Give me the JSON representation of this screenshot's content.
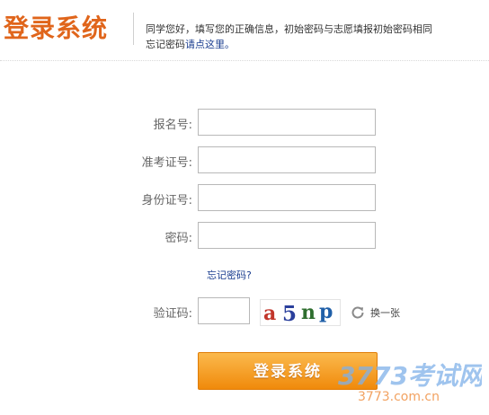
{
  "header": {
    "title": "登录系统",
    "intro_text": "同学您好，填写您的正确信息，初始密码与志愿填报初始密码相同",
    "intro_line2_prefix": "忘记密码",
    "intro_link": "请点这里。"
  },
  "form": {
    "fields": [
      {
        "label": "报名号:",
        "value": ""
      },
      {
        "label": "准考证号:",
        "value": ""
      },
      {
        "label": "身份证号:",
        "value": ""
      },
      {
        "label": "密码:",
        "value": ""
      }
    ],
    "forgot_link": "忘记密码?",
    "captcha": {
      "label": "验证码:",
      "value": "",
      "image_text": "a5np",
      "refresh_label": "换一张"
    },
    "submit_label": "登录系统"
  },
  "watermark": {
    "brand": "3773考试网",
    "url": "3773.com.cn"
  },
  "colors": {
    "brand_orange": "#e0651b",
    "button_top": "#fbb94d",
    "button_bottom": "#f08a0b",
    "link_blue": "#1a3d8f",
    "watermark_blue": "#2f6fc4"
  },
  "icons": {
    "refresh": "refresh-icon"
  }
}
